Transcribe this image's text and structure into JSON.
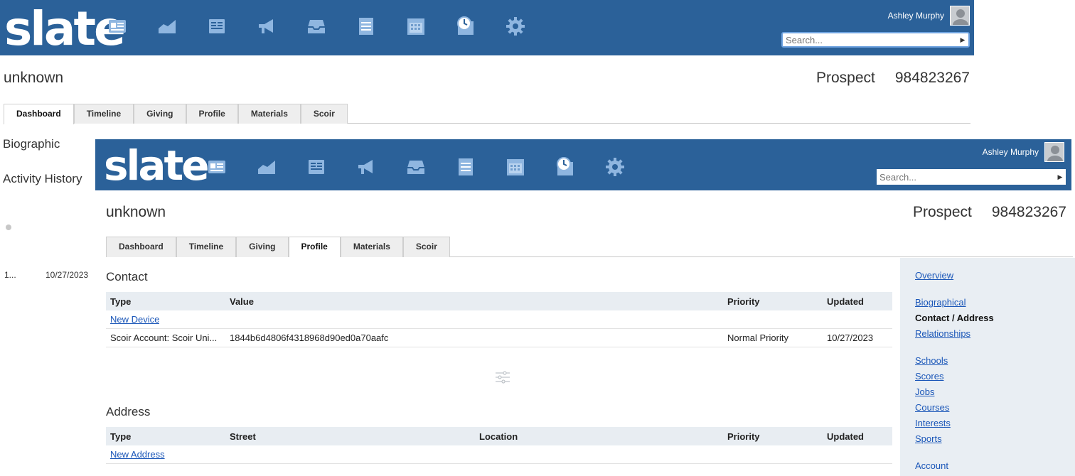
{
  "app": {
    "logo": "slate",
    "user_name": "Ashley Murphy",
    "search_placeholder": "Search...",
    "search_arrow": "▶",
    "nav_icons": [
      "person-card-icon",
      "chart-icon",
      "book-icon",
      "megaphone-icon",
      "inbox-icon",
      "list-icon",
      "calendar-icon",
      "clock-icon",
      "gear-icon"
    ]
  },
  "record": {
    "name": "unknown",
    "status": "Prospect",
    "id": "984823267"
  },
  "tabs": [
    "Dashboard",
    "Timeline",
    "Giving",
    "Profile",
    "Materials",
    "Scoir"
  ],
  "back": {
    "active_tab": "Dashboard",
    "sidebar": [
      "Biographic",
      "Activity History"
    ],
    "activity": {
      "col1": "1...",
      "date": "10/27/2023"
    }
  },
  "front": {
    "active_tab": "Profile",
    "contact": {
      "title": "Contact",
      "headers": [
        "Type",
        "Value",
        "Priority",
        "Updated"
      ],
      "new_link": "New Device",
      "rows": [
        {
          "type": "Scoir Account: Scoir Uni...",
          "value": "1844b6d4806f4318968d90ed0a70aafc",
          "priority": "Normal Priority",
          "updated": "10/27/2023"
        }
      ]
    },
    "address": {
      "title": "Address",
      "headers": [
        "Type",
        "Street",
        "Location",
        "Priority",
        "Updated"
      ],
      "new_link": "New Address"
    },
    "right_nav": {
      "overview": "Overview",
      "biographical": "Biographical",
      "current": "Contact / Address",
      "relationships": "Relationships",
      "schools": "Schools",
      "scores": "Scores",
      "jobs": "Jobs",
      "courses": "Courses",
      "interests": "Interests",
      "sports": "Sports",
      "account": "Account"
    }
  },
  "colors": {
    "header_blue": "#2b6199",
    "link_blue": "#1a56b8",
    "table_header": "#e8edf2"
  }
}
